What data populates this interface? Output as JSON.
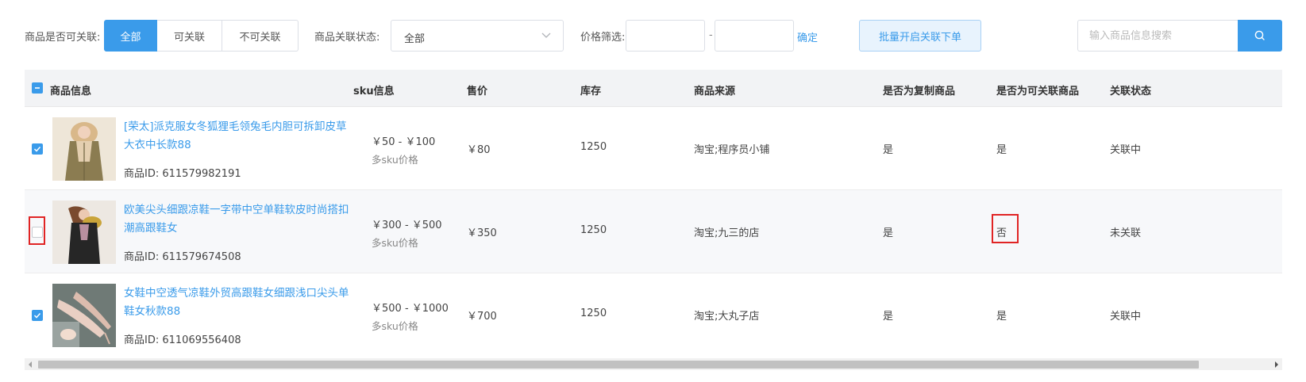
{
  "filters": {
    "linkable_label": "商品是否可关联:",
    "linkable_options": [
      "全部",
      "可关联",
      "不可关联"
    ],
    "linkable_selected": "全部",
    "status_label": "商品关联状态:",
    "status_value": "全部",
    "price_label": "价格筛选:",
    "price_min": "",
    "price_max": "",
    "price_dash": "-",
    "confirm_label": "确定",
    "batch_button": "批量开启关联下单",
    "search_placeholder": "输入商品信息搜索",
    "search_icon": "search-icon"
  },
  "table": {
    "headers": {
      "product": "商品信息",
      "sku": "sku信息",
      "price": "售价",
      "stock": "库存",
      "source": "商品来源",
      "is_copy": "是否为复制商品",
      "is_linkable": "是否为可关联商品",
      "link_status": "关联状态"
    },
    "header_checkbox": "indeterminate",
    "rows": [
      {
        "checked": true,
        "name": "[荣太]派克服女冬狐狸毛领兔毛内胆可拆卸皮草大衣中长款88",
        "product_id": "商品ID: 611579982191",
        "sku_range": "￥50 - ￥100",
        "sku_note": "多sku价格",
        "price": "￥80",
        "stock": "1250",
        "source": "淘宝;程序员小铺",
        "is_copy": "是",
        "is_linkable": "是",
        "link_status": "关联中"
      },
      {
        "checked": false,
        "name": "欧美尖头细跟凉鞋一字带中空单鞋软皮时尚搭扣潮高跟鞋女",
        "product_id": "商品ID: 611579674508",
        "sku_range": "￥300 - ￥500",
        "sku_note": "多sku价格",
        "price": "￥350",
        "stock": "1250",
        "source": "淘宝;九三的店",
        "is_copy": "是",
        "is_linkable": "否",
        "link_status": "未关联"
      },
      {
        "checked": true,
        "name": "女鞋中空透气凉鞋外贸高跟鞋女细跟浅口尖头单鞋女秋款88",
        "product_id": "商品ID: 611069556408",
        "sku_range": "￥500 - ￥1000",
        "sku_note": "多sku价格",
        "price": "￥700",
        "stock": "1250",
        "source": "淘宝;大丸子店",
        "is_copy": "是",
        "is_linkable": "是",
        "link_status": "关联中"
      }
    ]
  },
  "colors": {
    "accent": "#3a9bea",
    "highlight": "#e02424",
    "header_bg": "#f2f3f5"
  }
}
